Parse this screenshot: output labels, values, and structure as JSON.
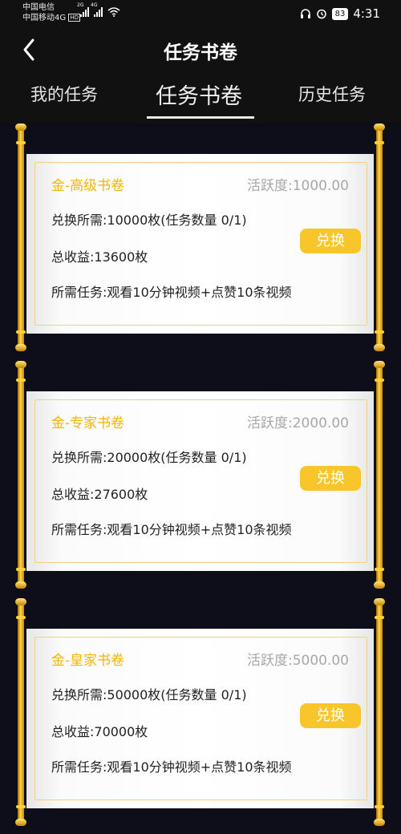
{
  "status_bar": {
    "carrier_1": "中国电信",
    "carrier_2": "中国移动4G",
    "hd_badge": "HD",
    "signal_1_tag": "2G",
    "signal_2_tag": "4G",
    "battery": "83",
    "time": "4:31"
  },
  "header": {
    "title": "任务书卷"
  },
  "tabs": [
    {
      "label": "我的任务"
    },
    {
      "label": "任务书卷"
    },
    {
      "label": "历史任务"
    }
  ],
  "cards": [
    {
      "title": "金-高级书卷",
      "activity": "活跃度:1000.00",
      "requirement": "兑换所需:10000枚(任务数量 0/1)",
      "income": "总收益:13600枚",
      "task": "所需任务:观看10分钟视频+点赞10条视频",
      "button": "兑换"
    },
    {
      "title": "金-专家书卷",
      "activity": "活跃度:2000.00",
      "requirement": "兑换所需:20000枚(任务数量 0/1)",
      "income": "总收益:27600枚",
      "task": "所需任务:观看10分钟视频+点赞10条视频",
      "button": "兑换"
    },
    {
      "title": "金-皇家书卷",
      "activity": "活跃度:5000.00",
      "requirement": "兑换所需:50000枚(任务数量 0/1)",
      "income": "总收益:70000枚",
      "task": "所需任务:观看10分钟视频+点赞10条视频",
      "button": "兑换"
    }
  ],
  "colors": {
    "accent": "#f8c62a",
    "title_gold": "#f2b500",
    "background": "#0e0e1a"
  }
}
